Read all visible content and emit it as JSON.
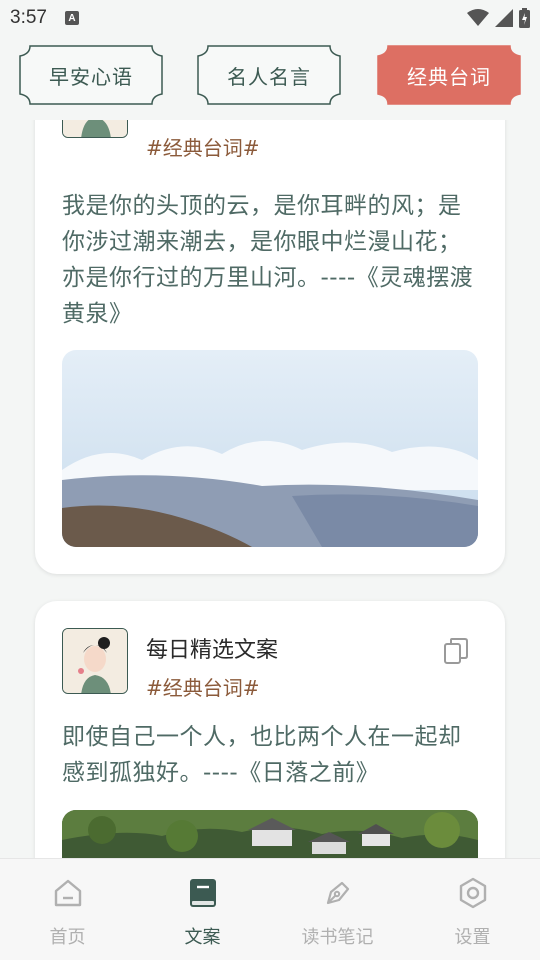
{
  "status": {
    "time": "3:57",
    "notification": "A"
  },
  "tabs": [
    {
      "label": "早安心语",
      "active": false
    },
    {
      "label": "名人名言",
      "active": false
    },
    {
      "label": "经典台词",
      "active": true
    }
  ],
  "colors": {
    "accent": "#dd6f63",
    "primary": "#3c5a52",
    "tag": "#8b5a3a",
    "text": "#4f6a65"
  },
  "cards": [
    {
      "title": "",
      "tag": "#经典台词#",
      "text": "我是你的头顶的云，是你耳畔的风；是你涉过潮来潮去，是你眼中烂漫山花；亦是你行过的万里山河。----《灵魂摆渡黄泉》",
      "image": "mountain-sky"
    },
    {
      "title": "每日精选文案",
      "tag": "#经典台词#",
      "text": "即使自己一个人，也比两个人在一起却感到孤独好。----《日落之前》",
      "image": "village-forest"
    }
  ],
  "nav": [
    {
      "label": "首页",
      "icon": "home-icon",
      "active": false
    },
    {
      "label": "文案",
      "icon": "book-icon",
      "active": true
    },
    {
      "label": "读书笔记",
      "icon": "pen-icon",
      "active": false
    },
    {
      "label": "设置",
      "icon": "settings-icon",
      "active": false
    }
  ]
}
